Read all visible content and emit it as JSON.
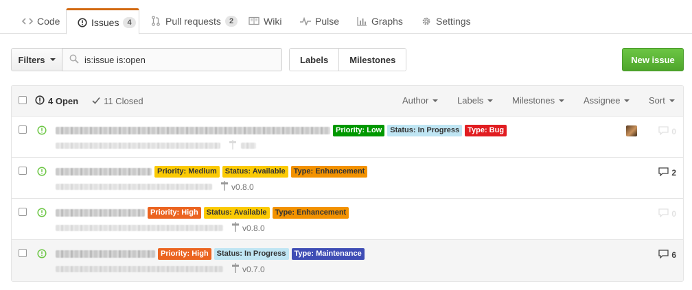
{
  "tabs": [
    {
      "label": "Code",
      "icon": "code-icon"
    },
    {
      "label": "Issues",
      "count": "4",
      "icon": "issue-opened-icon",
      "selected": true
    },
    {
      "label": "Pull requests",
      "count": "2",
      "icon": "git-pull-request-icon"
    },
    {
      "label": "Wiki",
      "icon": "book-icon"
    },
    {
      "label": "Pulse",
      "icon": "pulse-icon"
    },
    {
      "label": "Graphs",
      "icon": "graph-icon"
    },
    {
      "label": "Settings",
      "icon": "gear-icon"
    }
  ],
  "toolbar": {
    "filters_label": "Filters",
    "search_value": "is:issue is:open",
    "labels_label": "Labels",
    "milestones_label": "Milestones",
    "new_issue_label": "New issue"
  },
  "list_header": {
    "open_label": "4 Open",
    "closed_label": "11 Closed",
    "author": "Author",
    "labels": "Labels",
    "milestones": "Milestones",
    "assignee": "Assignee",
    "sort": "Sort"
  },
  "issues": [
    {
      "labels": [
        {
          "text": "Priority: Low",
          "bg": "#009800",
          "fg": "#ffffff"
        },
        {
          "text": "Status: In Progress",
          "bg": "#bfe5f3",
          "fg": "#333333"
        },
        {
          "text": "Type: Bug",
          "bg": "#e11d21",
          "fg": "#ffffff"
        }
      ],
      "milestone": "",
      "comments": "0",
      "has_avatar": true
    },
    {
      "labels": [
        {
          "text": "Priority: Medium",
          "bg": "#fbca04",
          "fg": "#333333"
        },
        {
          "text": "Status: Available",
          "bg": "#fbca04",
          "fg": "#333333"
        },
        {
          "text": "Type: Enhancement",
          "bg": "#f39200",
          "fg": "#333333"
        }
      ],
      "milestone": "v0.8.0",
      "comments": "2",
      "has_avatar": false
    },
    {
      "labels": [
        {
          "text": "Priority: High",
          "bg": "#eb6420",
          "fg": "#ffffff"
        },
        {
          "text": "Status: Available",
          "bg": "#fbca04",
          "fg": "#333333"
        },
        {
          "text": "Type: Enhancement",
          "bg": "#f39200",
          "fg": "#333333"
        }
      ],
      "milestone": "v0.8.0",
      "comments": "0",
      "has_avatar": false
    },
    {
      "labels": [
        {
          "text": "Priority: High",
          "bg": "#eb6420",
          "fg": "#ffffff"
        },
        {
          "text": "Status: In Progress",
          "bg": "#bfe5f3",
          "fg": "#333333"
        },
        {
          "text": "Type: Maintenance",
          "bg": "#3f4db5",
          "fg": "#ffffff"
        }
      ],
      "milestone": "v0.7.0",
      "comments": "6",
      "has_avatar": false
    }
  ],
  "colors": {
    "accent_tab": "#d26911",
    "open_icon": "#6cc644",
    "new_issue_bg": "#6cc644"
  }
}
